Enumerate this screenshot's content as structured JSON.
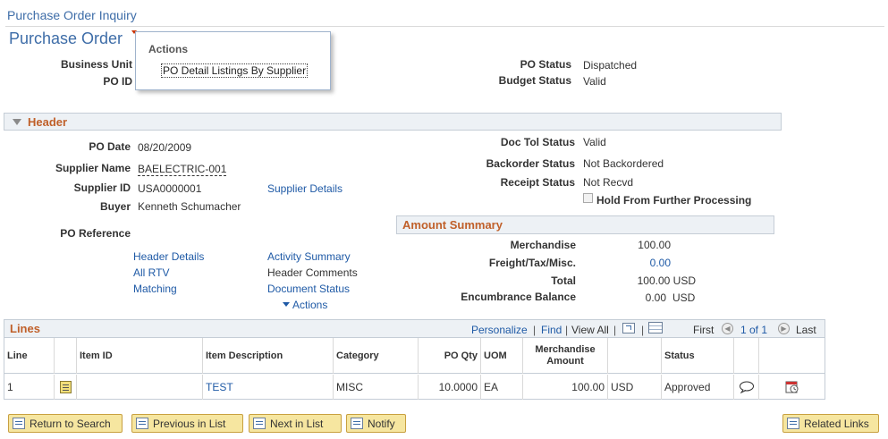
{
  "breadcrumb": "Purchase Order Inquiry",
  "page_title": "Purchase Order",
  "popup": {
    "title": "Actions",
    "item": "PO Detail Listings By Supplier"
  },
  "po_key": {
    "business_unit_label": "Business Unit",
    "po_id_label": "PO ID",
    "po_status_label": "PO Status",
    "po_status": "Dispatched",
    "budget_status_label": "Budget Status",
    "budget_status": "Valid"
  },
  "header_section": {
    "title": "Header",
    "po_date_label": "PO Date",
    "po_date": "08/20/2009",
    "supplier_name_label": "Supplier Name",
    "supplier_name": "BAELECTRIC-001",
    "supplier_id_label": "Supplier ID",
    "supplier_id": "USA0000001",
    "supplier_details_link": "Supplier Details",
    "buyer_label": "Buyer",
    "buyer": "Kenneth Schumacher",
    "po_reference_label": "PO Reference",
    "doc_tol_status_label": "Doc Tol Status",
    "doc_tol_status": "Valid",
    "backorder_status_label": "Backorder Status",
    "backorder_status": "Not Backordered",
    "receipt_status_label": "Receipt Status",
    "receipt_status": "Not Recvd",
    "hold_label": "Hold From Further Processing",
    "links": {
      "header_details": "Header Details",
      "all_rtv": "All RTV",
      "matching": "Matching",
      "activity_summary": "Activity Summary",
      "header_comments": "Header Comments",
      "document_status": "Document Status",
      "actions": "Actions"
    }
  },
  "amount_summary": {
    "title": "Amount Summary",
    "merchandise_label": "Merchandise",
    "merchandise": "100.00",
    "freight_label": "Freight/Tax/Misc.",
    "freight": "0.00",
    "total_label": "Total",
    "total": "100.00 USD",
    "encumbrance_label": "Encumbrance Balance",
    "encumbrance": "0.00",
    "encumbrance_currency": "USD"
  },
  "lines": {
    "title": "Lines",
    "nav": {
      "personalize": "Personalize",
      "sep": "|",
      "find": "Find",
      "view_all": "View All",
      "first": "First",
      "page": "1 of 1",
      "last": "Last"
    },
    "columns": {
      "line": "Line",
      "item_id": "Item ID",
      "item_description": "Item Description",
      "category": "Category",
      "po_qty": "PO Qty",
      "uom": "UOM",
      "merchandise_amount": "Merchandise Amount",
      "status": "Status"
    },
    "rows": [
      {
        "line": "1",
        "item_id": "",
        "item_description": "TEST",
        "category": "MISC",
        "po_qty": "10.0000",
        "uom": "EA",
        "merchandise_amount": "100.00",
        "currency": "USD",
        "status": "Approved"
      }
    ]
  },
  "buttons": {
    "return_to_search": "Return to Search",
    "previous_in_list": "Previous in List",
    "next_in_list": "Next in List",
    "notify": "Notify",
    "related_links": "Related Links"
  }
}
